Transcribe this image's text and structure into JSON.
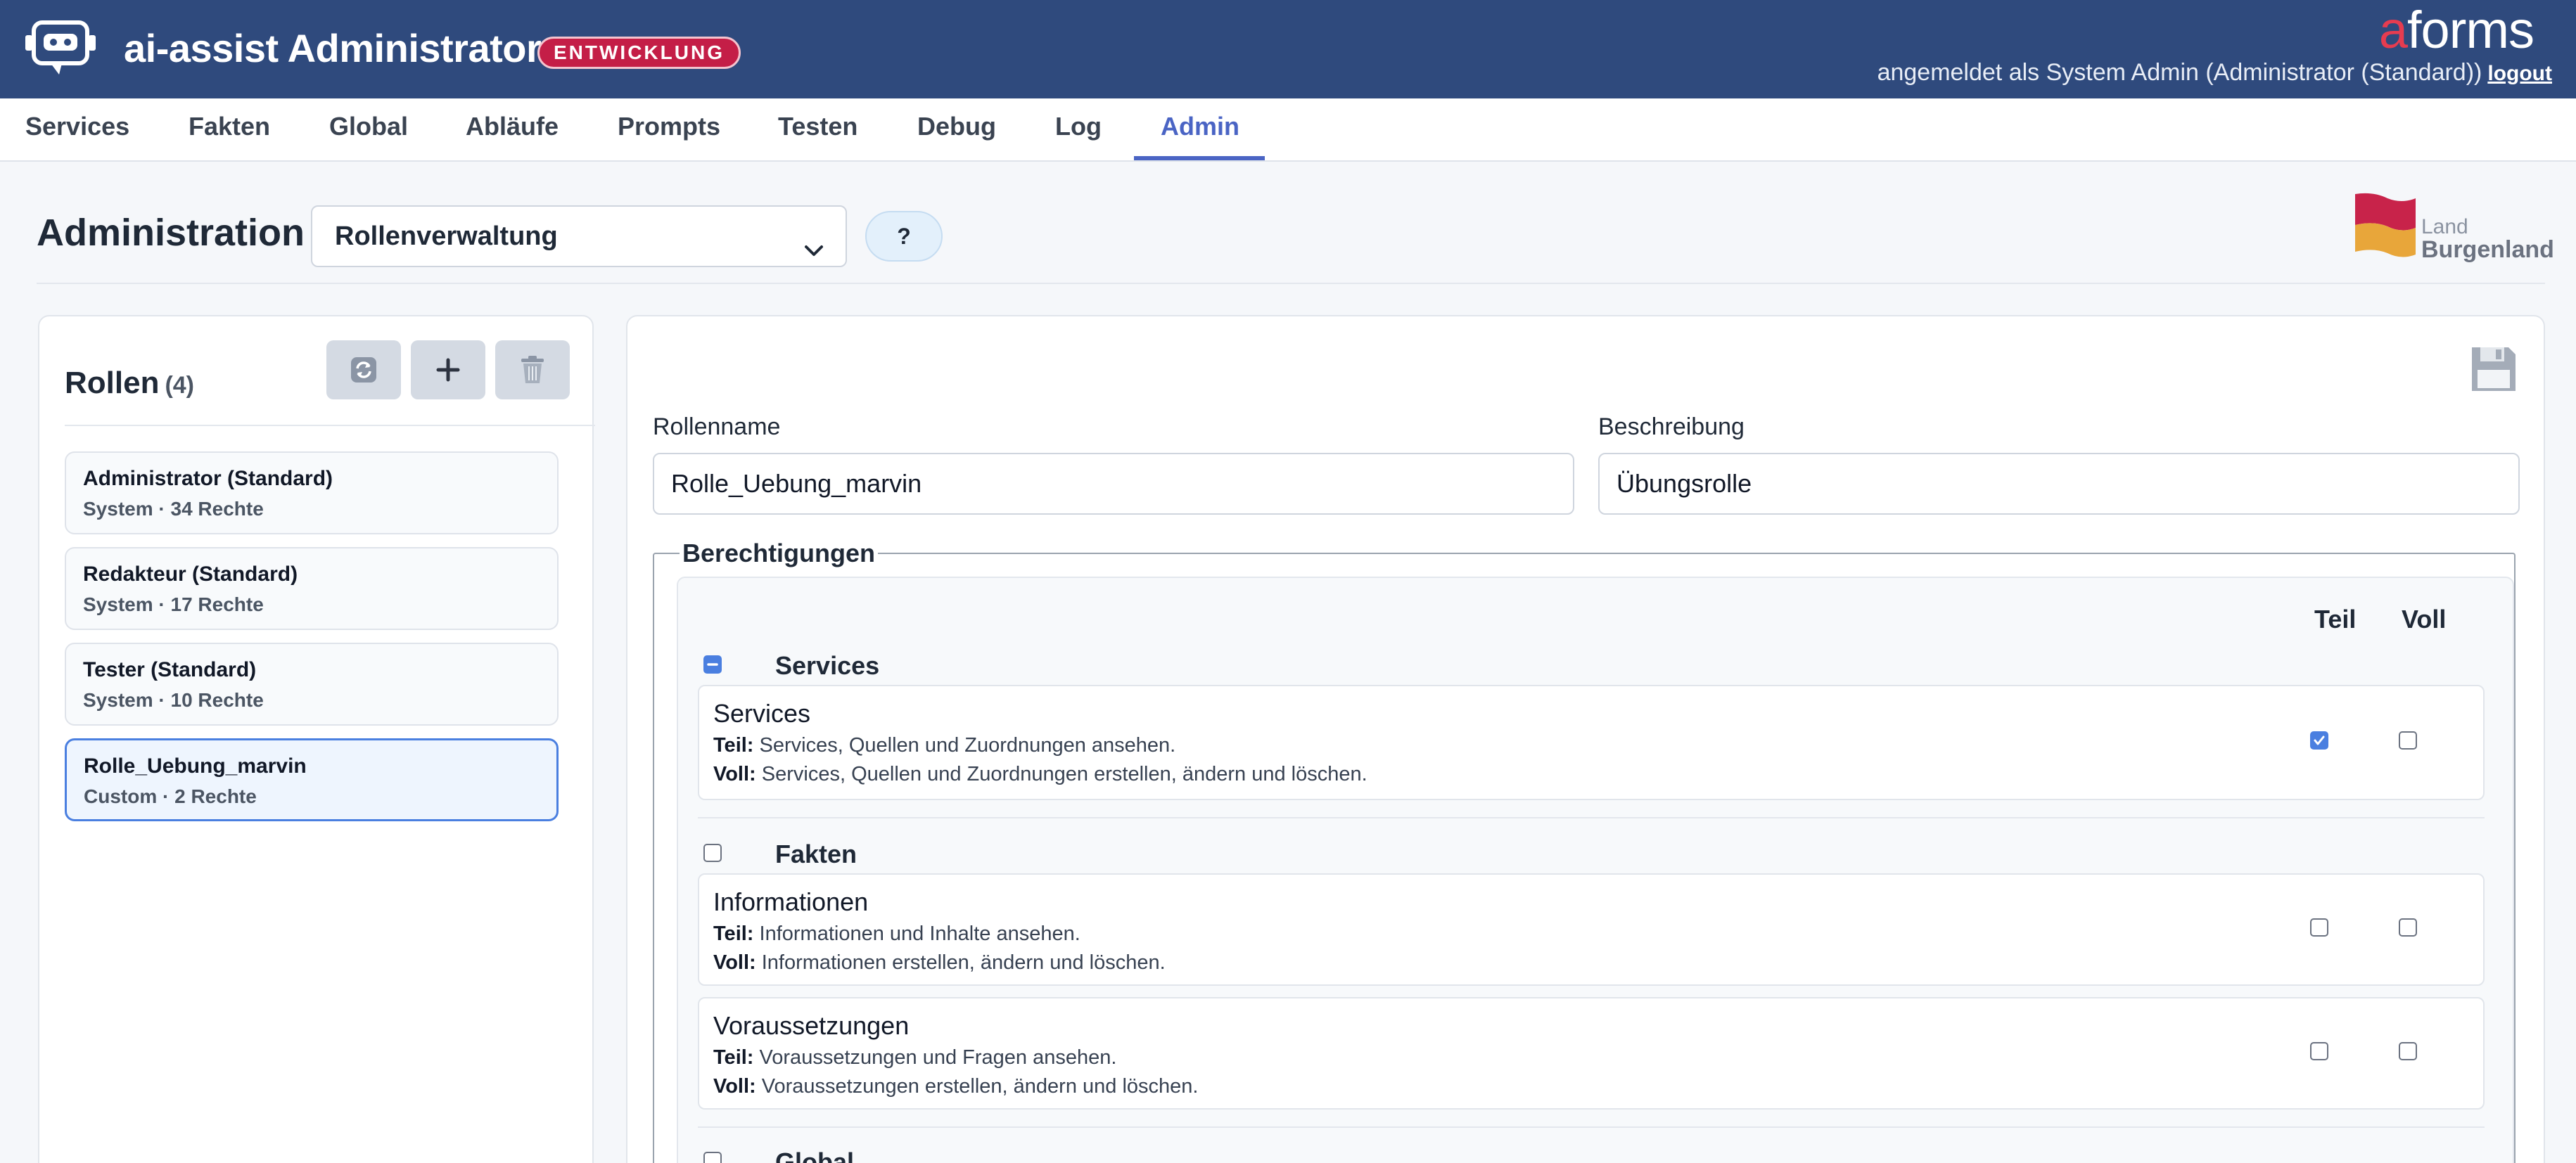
{
  "header": {
    "app_title": "ai-assist Administrator",
    "env_badge": "ENTWICKLUNG",
    "brand_a": "a",
    "brand_rest": "forms",
    "user_text": "angemeldet als System Admin (Administrator (Standard))",
    "logout": "logout"
  },
  "nav": {
    "items": [
      "Services",
      "Fakten",
      "Global",
      "Abläufe",
      "Prompts",
      "Testen",
      "Debug",
      "Log",
      "Admin"
    ],
    "active": "Admin"
  },
  "admin": {
    "title": "Administration",
    "select_value": "Rollenverwaltung",
    "help": "?",
    "logo_land": "Land",
    "logo_burgenland": "Burgenland"
  },
  "roles": {
    "title": "Rollen",
    "count": "(4)",
    "items": [
      {
        "name": "Administrator (Standard)",
        "meta": "System · 34 Rechte",
        "selected": false
      },
      {
        "name": "Redakteur (Standard)",
        "meta": "System · 17 Rechte",
        "selected": false
      },
      {
        "name": "Tester (Standard)",
        "meta": "System · 10 Rechte",
        "selected": false
      },
      {
        "name": "Rolle_Uebung_marvin",
        "meta": "Custom · 2 Rechte",
        "selected": true
      }
    ]
  },
  "editor": {
    "rolename_label": "Rollenname",
    "rolename_value": "Rolle_Uebung_marvin",
    "description_label": "Beschreibung",
    "description_value": "Übungsrolle",
    "permissions_legend": "Berechtigungen",
    "col_partial": "Teil",
    "col_full": "Voll",
    "groups": [
      {
        "name": "Services",
        "state": "indeterminate",
        "items": [
          {
            "title": "Services",
            "teil_label": "Teil:",
            "teil": "Services, Quellen und Zuordnungen ansehen.",
            "voll_label": "Voll:",
            "voll": "Services, Quellen und Zuordnungen erstellen, ändern und löschen.",
            "teil_checked": true,
            "voll_checked": false
          }
        ]
      },
      {
        "name": "Fakten",
        "state": "unchecked",
        "items": [
          {
            "title": "Informationen",
            "teil_label": "Teil:",
            "teil": "Informationen und Inhalte ansehen.",
            "voll_label": "Voll:",
            "voll": "Informationen erstellen, ändern und löschen.",
            "teil_checked": false,
            "voll_checked": false
          },
          {
            "title": "Voraussetzungen",
            "teil_label": "Teil:",
            "teil": "Voraussetzungen und Fragen ansehen.",
            "voll_label": "Voll:",
            "voll": "Voraussetzungen erstellen, ändern und löschen.",
            "teil_checked": false,
            "voll_checked": false
          }
        ]
      },
      {
        "name": "Global",
        "state": "unchecked",
        "items": []
      }
    ]
  },
  "colors": {
    "header_bg": "#2f4a7d",
    "accent": "#4a64c4",
    "badge": "#c41e47",
    "checkbox_checked": "#4a7fe0"
  }
}
